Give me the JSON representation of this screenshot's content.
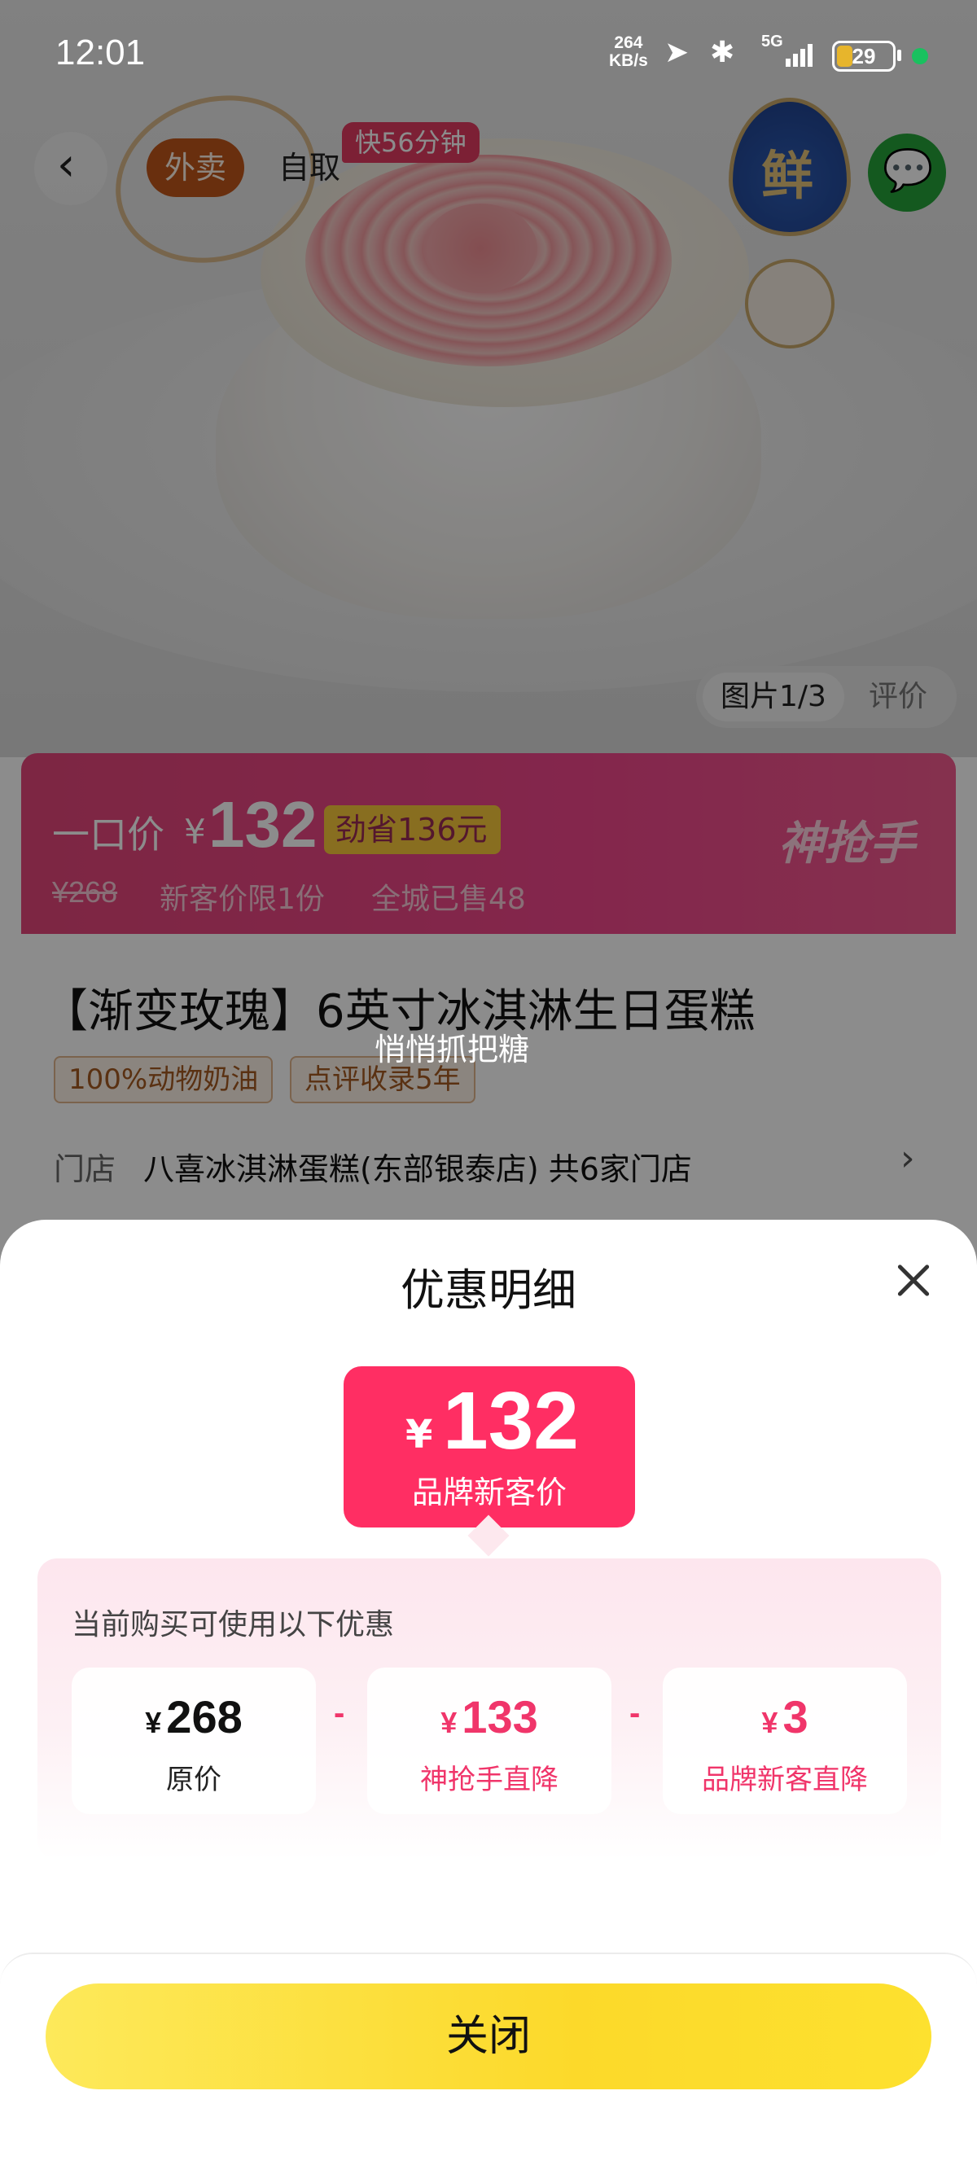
{
  "status_bar": {
    "time": "12:01",
    "net_speed_value": "264",
    "net_speed_unit": "KB/s",
    "network": "5G",
    "battery": "29",
    "battery_level": 0.29,
    "battery_color": "#e7b52c",
    "icons": [
      "location-arrow-icon",
      "bluetooth-icon",
      "signal-icon",
      "battery-icon",
      "green-dot-icon"
    ]
  },
  "product_header": {
    "tab_delivery": "外卖",
    "tab_pickup": "自取",
    "delivery_badge": "快56分钟",
    "fresh_mark": "鲜",
    "gallery_index": "图片1/3",
    "reviews_tab": "评价"
  },
  "price_bar": {
    "label": "一口价",
    "currency": "¥",
    "price": "132",
    "saving_badge": "劲省136元",
    "original_price": "¥268",
    "new_customer_limit": "新客价限1份",
    "sold": "全城已售48",
    "program_logo": "神抢手",
    "accent_color": "#f0468b"
  },
  "product_info": {
    "title": "【渐变玫瑰】6英寸冰淇淋生日蛋糕",
    "tags": [
      "100%动物奶油",
      "点评收录5年"
    ],
    "store_label": "门店",
    "store_value": "八喜冰淇淋蛋糕(东部银泰店)  共6家门店"
  },
  "toast": "悄悄抓把糖",
  "discount_sheet": {
    "title": "优惠明细",
    "final_currency": "¥",
    "final_price": "132",
    "final_label": "品牌新客价",
    "available_hint": "当前购买可使用以下优惠",
    "operator": "-",
    "items": [
      {
        "currency": "¥",
        "amount": "268",
        "label": "原价",
        "color": "#111111"
      },
      {
        "currency": "¥",
        "amount": "133",
        "label": "神抢手直降",
        "color": "#f0356a"
      },
      {
        "currency": "¥",
        "amount": "3",
        "label": "品牌新客直降",
        "color": "#f0356a"
      }
    ],
    "close_button": "关闭",
    "button_color": "#fcd92a"
  }
}
